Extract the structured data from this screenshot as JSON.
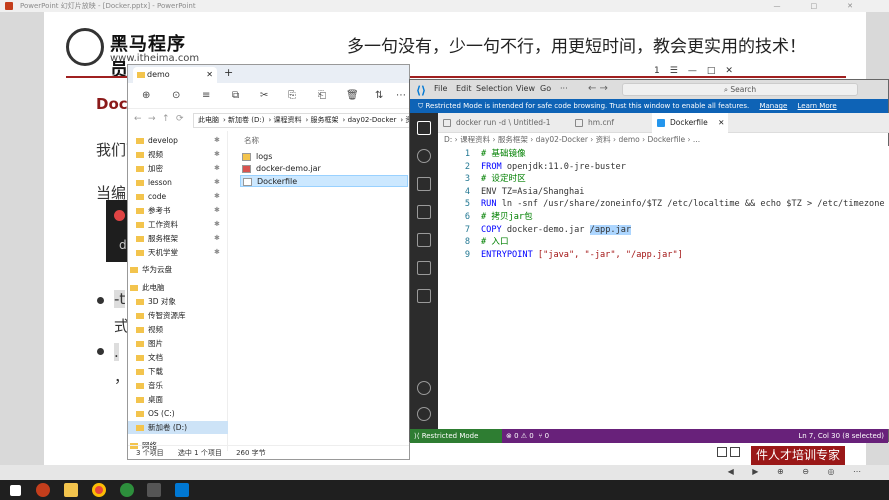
{
  "powerpoint": {
    "window_title": "PowerPoint 幻灯片放映 - [Docker.pptx] - PowerPoint",
    "window_controls": [
      "—",
      "□",
      "✕"
    ],
    "slide": {
      "logo_name": "黑马程序员",
      "logo_url": "www.itheima.com",
      "slogan": "多一句没有，少一句不行，用更短时间，教会更实用的技术！",
      "title_fragment": "Doc",
      "line1_fragment": "我们可",
      "line2_fragment": "当编写",
      "dark_box_char": "d",
      "bullet1_text": "-t",
      "bullet1_sub": "式",
      "bullet2_text": ".",
      "bullet2_sub": "，",
      "banner_text": "件人才培训专家"
    }
  },
  "explorer": {
    "tab_title": "demo",
    "tab_close": "✕",
    "new_tab": "+",
    "toolbar_icons": [
      "⊕",
      "⊙",
      "≡",
      "⧉",
      "✂",
      "⎘",
      "⎗",
      "🗑",
      "⇅",
      "⋯"
    ],
    "nav_arrows": [
      "←",
      "→",
      "↑",
      "⟳"
    ],
    "breadcrumb": [
      "此电脑",
      "新加卷 (D:)",
      "课程资料",
      "服务框架",
      "day02-Docker",
      "资"
    ],
    "nav_items": [
      {
        "label": "develop",
        "pinned": true
      },
      {
        "label": "视频",
        "pinned": true
      },
      {
        "label": "加密",
        "pinned": true
      },
      {
        "label": "lesson",
        "pinned": true
      },
      {
        "label": "code",
        "pinned": true
      },
      {
        "label": "参考书",
        "pinned": true
      },
      {
        "label": "工作资料",
        "pinned": true
      },
      {
        "label": "服务框架",
        "pinned": true
      },
      {
        "label": "天机学堂",
        "pinned": true
      },
      {
        "label": "华为云盘",
        "pinned": false
      },
      {
        "label": "此电脑",
        "pinned": false
      },
      {
        "label": "3D 对象",
        "pinned": false
      },
      {
        "label": "传智资源库",
        "pinned": false
      },
      {
        "label": "视频",
        "pinned": false
      },
      {
        "label": "图片",
        "pinned": false
      },
      {
        "label": "文档",
        "pinned": false
      },
      {
        "label": "下载",
        "pinned": false
      },
      {
        "label": "音乐",
        "pinned": false
      },
      {
        "label": "桌面",
        "pinned": false
      },
      {
        "label": "OS (C:)",
        "pinned": false
      },
      {
        "label": "新加卷 (D:)",
        "pinned": false
      },
      {
        "label": "网络",
        "pinned": false
      }
    ],
    "column_header": "名称",
    "files": [
      {
        "name": "logs",
        "type": "folder"
      },
      {
        "name": "docker-demo.jar",
        "type": "jar"
      },
      {
        "name": "Dockerfile",
        "type": "file"
      }
    ],
    "status": {
      "count": "3 个项目",
      "selected": "选中 1 个项目",
      "size": "260 字节"
    }
  },
  "vscode": {
    "menu": [
      "File",
      "Edit",
      "Selection",
      "View",
      "Go",
      "···"
    ],
    "search_placeholder": "Search",
    "window_controls": [
      "1",
      "☰",
      "—",
      "□",
      "✕"
    ],
    "notice_text": "Restricted Mode is intended for safe code browsing. Trust this window to enable all features.",
    "notice_manage": "Manage",
    "notice_learn": "Learn More",
    "tabs": [
      {
        "label": "docker run -d \\ Untitled-1",
        "active": false
      },
      {
        "label": "hm.cnf",
        "active": false
      },
      {
        "label": "Dockerfile",
        "active": true
      }
    ],
    "breadcrumb": "D: › 课程资料 › 服务框架 › day02-Docker › 资料 › demo › Dockerfile › ...",
    "code_lines": [
      {
        "n": "1",
        "parts": [
          {
            "t": "# 基础镜像",
            "c": "cm"
          }
        ]
      },
      {
        "n": "2",
        "parts": [
          {
            "t": "FROM ",
            "c": "kw"
          },
          {
            "t": "openjdk:11.0-jre-buster",
            "c": ""
          }
        ]
      },
      {
        "n": "3",
        "parts": [
          {
            "t": "# 设定时区",
            "c": "cm"
          }
        ]
      },
      {
        "n": "4",
        "parts": [
          {
            "t": "ENV TZ=Asia/Shanghai",
            "c": ""
          }
        ]
      },
      {
        "n": "5",
        "parts": [
          {
            "t": "RUN ",
            "c": "kw"
          },
          {
            "t": "ln -snf /usr/share/zoneinfo/$TZ /etc/localtime && echo $TZ > /etc/timezone",
            "c": ""
          }
        ]
      },
      {
        "n": "6",
        "parts": [
          {
            "t": "# 拷贝jar包",
            "c": "cm"
          }
        ]
      },
      {
        "n": "7",
        "parts": [
          {
            "t": "COPY ",
            "c": "kw"
          },
          {
            "t": "docker-demo.jar ",
            "c": ""
          },
          {
            "t": "/app.jar",
            "c": "hl"
          }
        ]
      },
      {
        "n": "8",
        "parts": [
          {
            "t": "# 入口",
            "c": "cm"
          }
        ]
      },
      {
        "n": "9",
        "parts": [
          {
            "t": "ENTRYPOINT ",
            "c": "kw"
          },
          {
            "t": "[\"java\", \"-jar\", \"/app.jar\"]",
            "c": "st"
          }
        ]
      }
    ],
    "status": {
      "restricted": "Restricted Mode",
      "problems": "⊗ 0 ⚠ 0",
      "ports": "⑂ 0",
      "position": "Ln 7, Col 30 (8 selected)"
    },
    "theme": {
      "activity_bar": "#2c2c2c",
      "statusbar": "#68217a",
      "notice": "#0e63b6"
    }
  },
  "taskbar": {
    "apps": [
      "windows-start",
      "powerpoint",
      "file-explorer",
      "chrome",
      "terminal",
      "vscode"
    ]
  }
}
